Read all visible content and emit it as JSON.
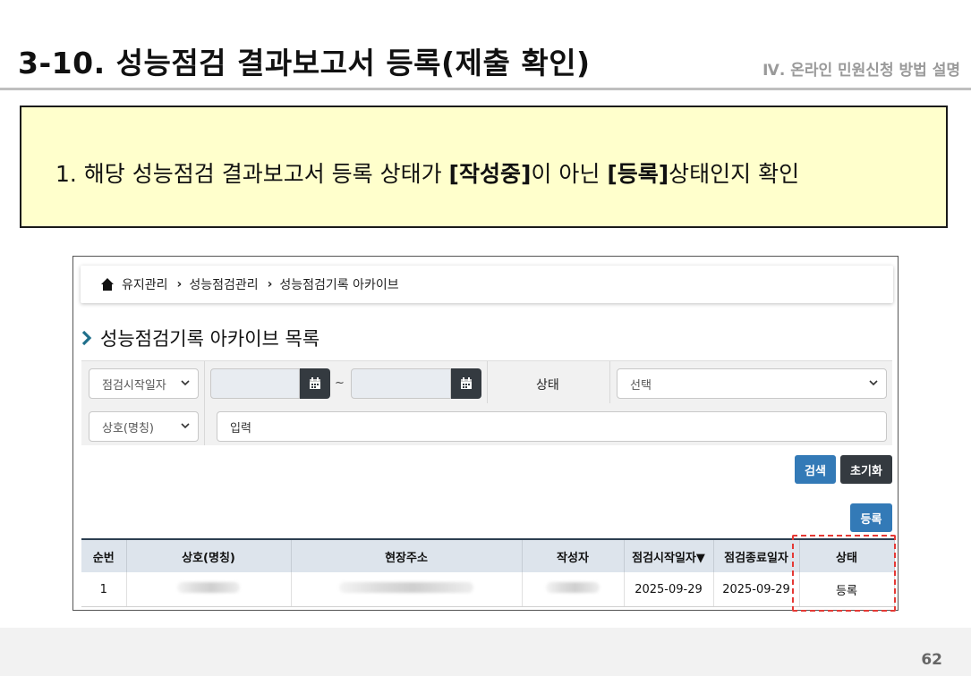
{
  "slide": {
    "title": "3-10. 성능점검 결과보고서 등록(제출 확인)",
    "section": "Ⅳ. 온라인 민원신청 방법 설명",
    "instruction_prefix": "1. 해당 성능점검 결과보고서 등록 상태가 ",
    "instruction_bold1": "[작성중]",
    "instruction_mid": "이 아닌 ",
    "instruction_bold2": "[등록]",
    "instruction_suffix": "상태인지 확인",
    "page_number": "62"
  },
  "screenshot": {
    "breadcrumb": [
      "유지관리",
      "성능점검관리",
      "성능점검기록 아카이브"
    ],
    "list_title": "성능점검기록 아카이브 목록",
    "filters": {
      "date_type_select": "점검시작일자",
      "date_from": "",
      "date_to": "",
      "date_separator": "~",
      "state_label": "상태",
      "state_select": "선택",
      "name_select": "상호(명칭)",
      "keyword_placeholder": "입력"
    },
    "buttons": {
      "search": "검색",
      "reset": "초기화",
      "register": "등록"
    },
    "table": {
      "columns": [
        "순번",
        "상호(명칭)",
        "현장주소",
        "작성자",
        "점검시작일자▼",
        "점검종료일자",
        "상태"
      ],
      "rows": [
        {
          "no": "1",
          "name": "",
          "address": "",
          "author": "",
          "start": "2025-09-29",
          "end": "2025-09-29",
          "state": "등록"
        }
      ]
    }
  },
  "icons": [
    "home-icon",
    "chevron-right-icon",
    "calendar-icon",
    "chevron-down-icon"
  ],
  "colors": {
    "callout_bg": "#ffffcc",
    "primary_button": "#337ab7",
    "dark_button": "#343a40",
    "highlight": "#e53935",
    "section_text": "#9a9a9a"
  }
}
